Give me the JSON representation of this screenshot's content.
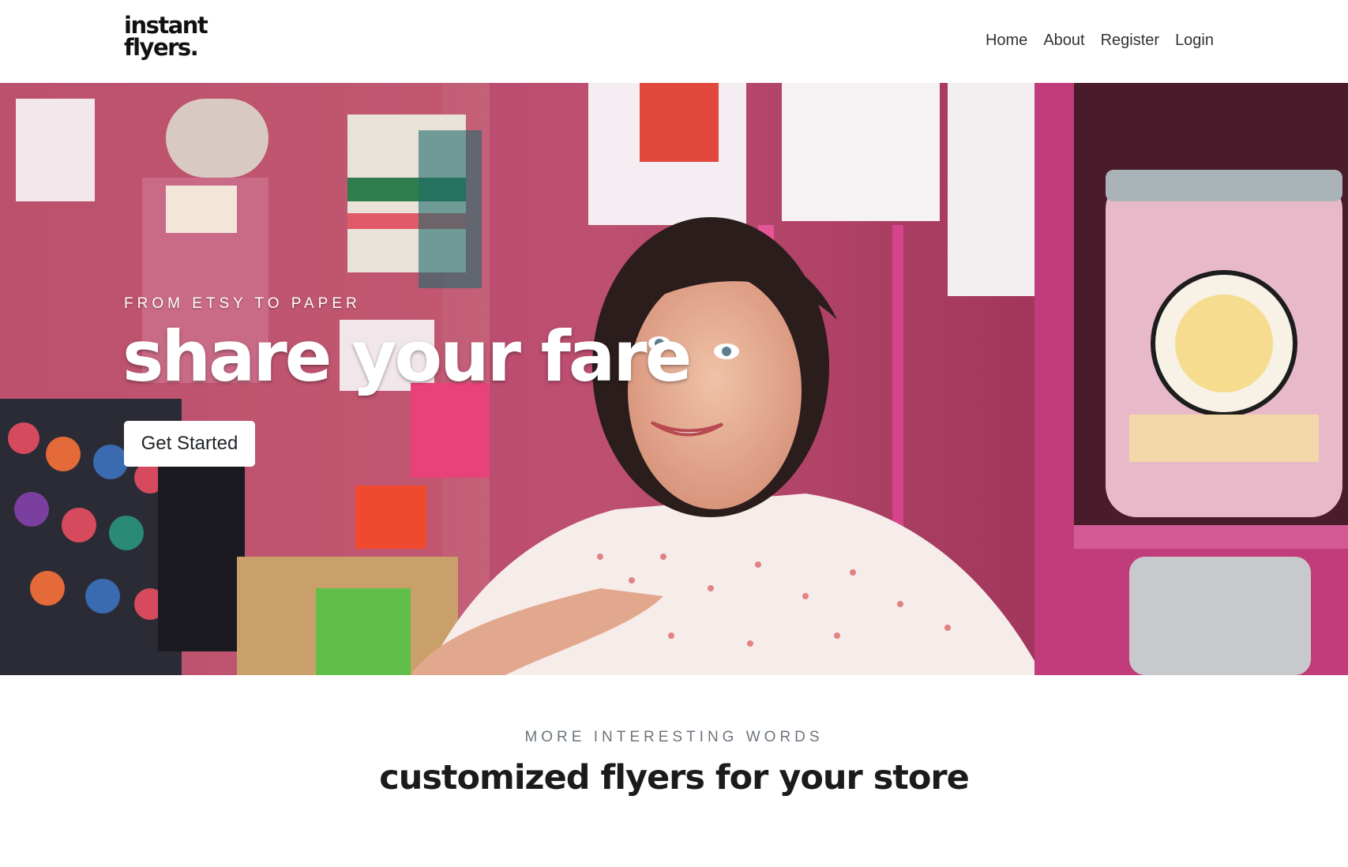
{
  "brand": {
    "line1": "instant",
    "line2": "flyers."
  },
  "nav": {
    "items": [
      "Home",
      "About",
      "Register",
      "Login"
    ]
  },
  "hero": {
    "eyebrow": "FROM ETSY TO PAPER",
    "headline": "share your fare",
    "cta_label": "Get Started"
  },
  "section": {
    "subheading": "MORE INTERESTING WORDS",
    "heading": "customized flyers for your store"
  },
  "colors": {
    "hero_bg": "#9a3b55",
    "accent_pink": "#d7438c",
    "text_dark": "#1b1b1b",
    "muted": "#6c757d"
  }
}
